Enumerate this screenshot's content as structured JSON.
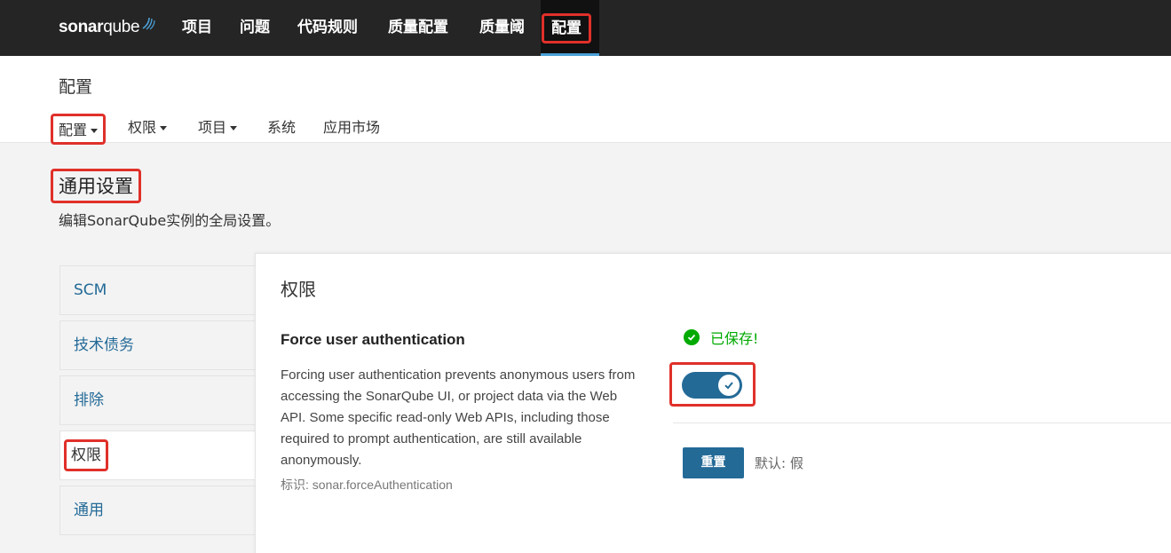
{
  "brand": {
    "name_bold": "sonar",
    "name_light": "qube"
  },
  "topnav": {
    "items": [
      "项目",
      "问题",
      "代码规则",
      "质量配置",
      "质量阈"
    ],
    "active": "配置"
  },
  "page": {
    "title": "配置",
    "subnav": [
      {
        "label": "配置",
        "dropdown": true
      },
      {
        "label": "权限",
        "dropdown": true
      },
      {
        "label": "项目",
        "dropdown": true
      },
      {
        "label": "系统",
        "dropdown": false
      },
      {
        "label": "应用市场",
        "dropdown": false
      }
    ]
  },
  "section": {
    "title": "通用设置",
    "description": "编辑SonarQube实例的全局设置。"
  },
  "categories": [
    "SCM",
    "技术债务",
    "排除",
    "权限",
    "通用"
  ],
  "panel": {
    "title": "权限",
    "setting": {
      "title": "Force user authentication",
      "description": "Forcing user authentication prevents anonymous users from accessing the SonarQube UI, or project data via the Web API. Some specific read-only Web APIs, including those required to prompt authentication, are still available anonymously.",
      "key": "标识: sonar.forceAuthentication",
      "saved_text": "已保存!",
      "toggle_on": true,
      "reset_label": "重置",
      "default_text": "默认: 假"
    }
  },
  "colors": {
    "accent": "#236a97",
    "nav_bg": "#252525",
    "highlight": "#e0302a",
    "success": "#00aa00"
  }
}
